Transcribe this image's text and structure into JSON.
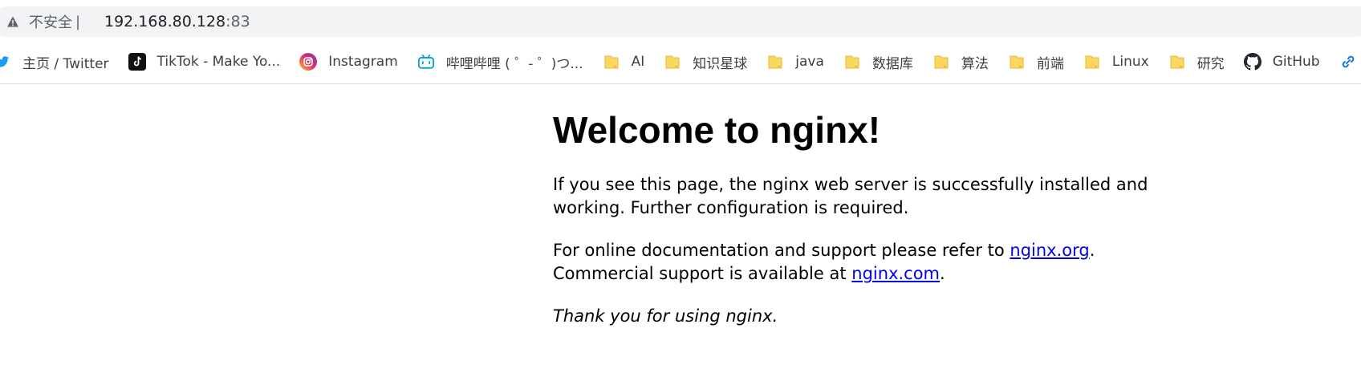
{
  "browser": {
    "security_label": "不安全",
    "separator": "|",
    "url_host": "192.168.80.128",
    "url_port": ":83"
  },
  "bookmarks": [
    {
      "label": "主页 / Twitter",
      "icon": "twitter-icon"
    },
    {
      "label": "TikTok - Make Yo...",
      "icon": "tiktok-icon"
    },
    {
      "label": "Instagram",
      "icon": "instagram-icon"
    },
    {
      "label": "哔哩哔哩 ( ゜- ゜)つ...",
      "icon": "bilibili-icon"
    },
    {
      "label": "AI",
      "icon": "folder-icon"
    },
    {
      "label": "知识星球",
      "icon": "folder-icon"
    },
    {
      "label": "java",
      "icon": "folder-icon"
    },
    {
      "label": "数据库",
      "icon": "folder-icon"
    },
    {
      "label": "算法",
      "icon": "folder-icon"
    },
    {
      "label": "前端",
      "icon": "folder-icon"
    },
    {
      "label": "Linux",
      "icon": "folder-icon"
    },
    {
      "label": "研究",
      "icon": "folder-icon"
    },
    {
      "label": "GitHub",
      "icon": "github-icon"
    }
  ],
  "page": {
    "heading": "Welcome to nginx!",
    "para1": "If you see this page, the nginx web server is successfully installed and working. Further configuration is required.",
    "para2_prefix": "For online documentation and support please refer to ",
    "link_org": "nginx.org",
    "para2_mid": ".",
    "para2_line2": "Commercial support is available at ",
    "link_com": "nginx.com",
    "para2_end": ".",
    "thanks": "Thank you for using nginx."
  },
  "colors": {
    "link": "#0000ee",
    "omnibox_bg": "#f1f3f4",
    "folder": "#fbd660"
  }
}
